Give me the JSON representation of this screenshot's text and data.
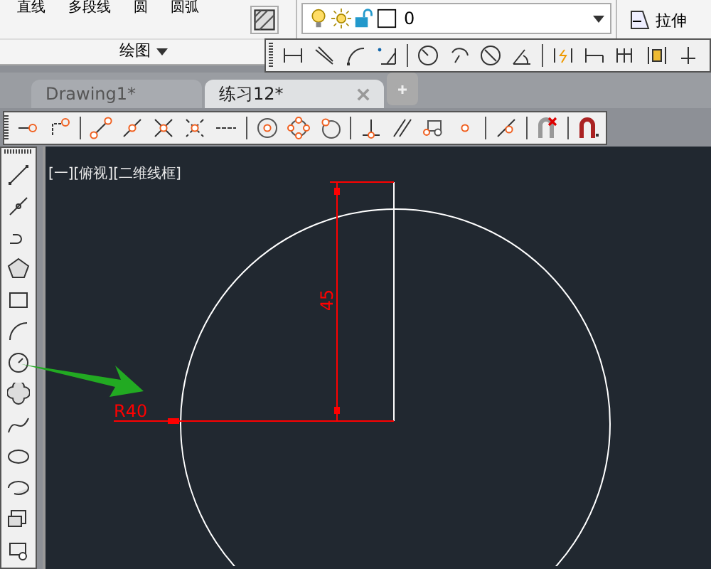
{
  "ribbon": {
    "draw_tools": [
      "直线",
      "多段线",
      "圆",
      "圆弧"
    ],
    "draw_panel_title": "绘图",
    "layer": {
      "value": "0"
    },
    "modify_tools": [
      "拉伸"
    ]
  },
  "file_tabs": [
    {
      "label": "Drawing1*",
      "selected": false
    },
    {
      "label": "练习12*",
      "selected": true
    }
  ],
  "viewport": {
    "label": "[一][俯视][二维线框]"
  },
  "drawing": {
    "radius_label": "R40",
    "height_label": "45"
  }
}
